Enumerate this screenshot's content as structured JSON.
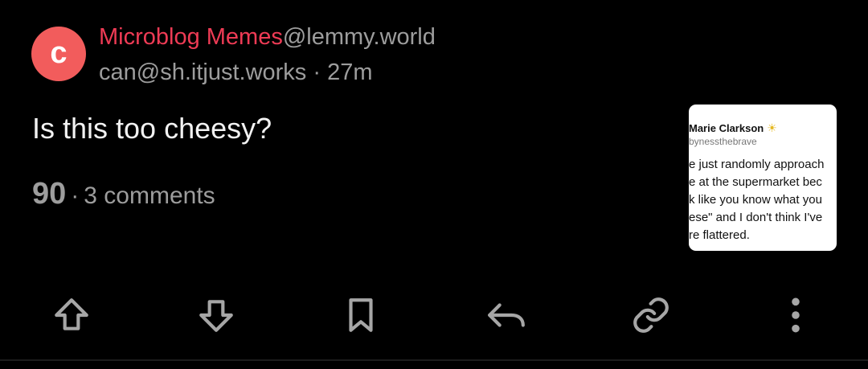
{
  "post": {
    "avatar_letter": "c",
    "community_name": "Microblog Memes",
    "community_instance": "@lemmy.world",
    "author": "can@sh.itjust.works",
    "separator": "·",
    "age": "27m",
    "title": "Is this too cheesy?",
    "score": "90",
    "comments": "3 comments"
  },
  "thumbnail": {
    "name": "Marie Clarkson",
    "name_icon": "sun-icon",
    "handle": "bynessthebrave",
    "lines": [
      "e just randomly approach",
      "e at the supermarket bec",
      "k like you know what you",
      "ese\" and I don't think I've",
      "re flattered."
    ]
  },
  "actions": {
    "icons": [
      "upvote-icon",
      "downvote-icon",
      "bookmark-icon",
      "reply-icon",
      "link-icon",
      "more-icon"
    ]
  },
  "colors": {
    "background": "#000000",
    "community": "#ee3b55",
    "avatar": "#f25c5c",
    "muted": "#9d9d9d",
    "title": "#f2f2f2"
  }
}
